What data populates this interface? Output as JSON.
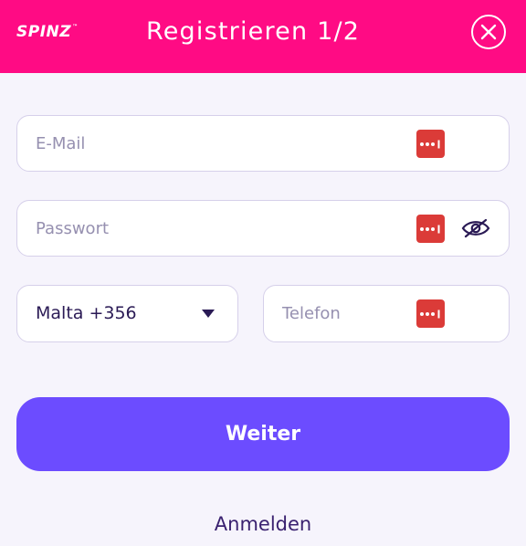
{
  "header": {
    "logo_text": "SPINZ",
    "logo_tm": "™",
    "title": "Registrieren 1/2",
    "close_icon": "close-circle-icon"
  },
  "form": {
    "email": {
      "placeholder": "E-Mail",
      "value": ""
    },
    "password": {
      "placeholder": "Passwort",
      "value": ""
    },
    "country_code": {
      "selected": "Malta +356"
    },
    "phone": {
      "placeholder": "Telefon",
      "value": ""
    },
    "submit_label": "Weiter",
    "login_label": "Anmelden"
  },
  "icons": {
    "password_manager": "password-manager-icon",
    "toggle_visibility": "eye-slash-icon",
    "dropdown": "caret-down-icon"
  },
  "colors": {
    "brand_pink": "#ff0b84",
    "primary_button": "#6c4cff",
    "password_manager_red": "#db3b38",
    "text_dark": "#2a1a55",
    "background": "#f6f4fc"
  }
}
